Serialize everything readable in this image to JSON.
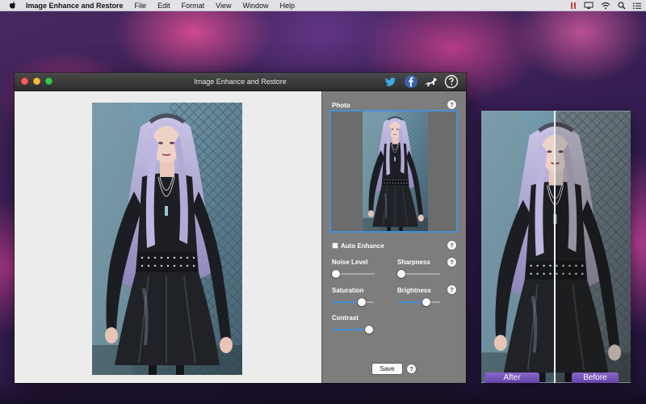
{
  "menubar": {
    "apple_icon": "apple-logo-icon",
    "items": [
      "Image Enhance and Restore",
      "File",
      "Edit",
      "Format",
      "View",
      "Window",
      "Help"
    ],
    "tray_icons": [
      "pause-icon",
      "cast-icon",
      "wifi-icon",
      "search-icon",
      "list-icon"
    ]
  },
  "window": {
    "title": "Image Enhance and Restore",
    "title_icons": [
      "twitter-icon",
      "facebook-icon",
      "dog-icon",
      "help-bubble-icon"
    ]
  },
  "panel": {
    "photo_label": "Photo",
    "help_glyph": "?",
    "auto_enhance_label": "Auto Enhance",
    "auto_enhance_checked": false,
    "sliders": {
      "noise_level": {
        "label": "Noise Level",
        "value": 0.0
      },
      "sharpness": {
        "label": "Sharpness",
        "value": 0.0
      },
      "saturation": {
        "label": "Saturation",
        "value": 0.72
      },
      "brightness": {
        "label": "Brightness",
        "value": 0.68
      },
      "contrast": {
        "label": "Contrast",
        "value": 0.88
      }
    },
    "save_label": "Save"
  },
  "compare": {
    "after_label": "After",
    "before_label": "Before"
  },
  "colors": {
    "accent": "#4a8fd6",
    "panel_bg": "#7d7d7d",
    "titlebar": "#333333",
    "tag": "#7656b8"
  }
}
